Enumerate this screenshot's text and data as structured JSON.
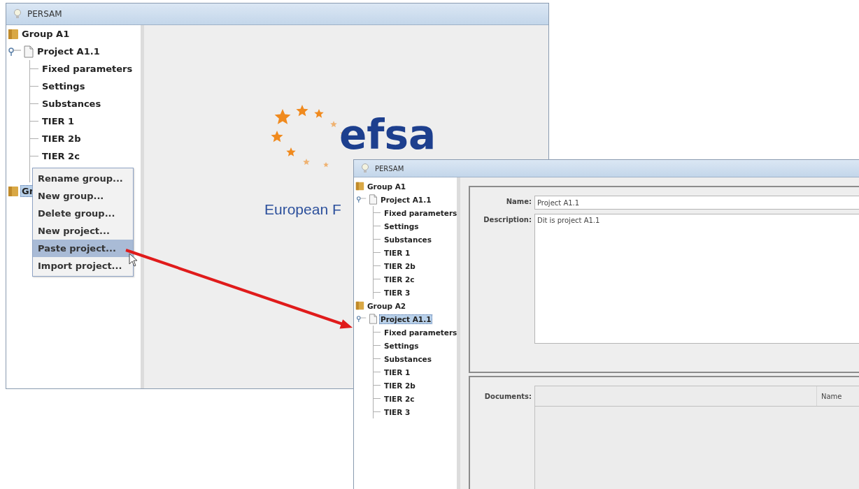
{
  "windows": [
    {
      "title": "PERSAM",
      "tree": [
        {
          "label": "Group A1",
          "kind": "group",
          "selected": false,
          "children": [
            {
              "label": "Project A1.1",
              "kind": "project",
              "selected": false,
              "children": [
                {
                  "label": "Fixed parameters",
                  "kind": "item",
                  "selected": false
                },
                {
                  "label": "Settings",
                  "kind": "item",
                  "selected": false
                },
                {
                  "label": "Substances",
                  "kind": "item",
                  "selected": false
                },
                {
                  "label": "TIER 1",
                  "kind": "item",
                  "selected": false
                },
                {
                  "label": "TIER 2b",
                  "kind": "item",
                  "selected": false
                },
                {
                  "label": "TIER 2c",
                  "kind": "item",
                  "selected": false
                }
              ]
            }
          ]
        },
        {
          "label": "Gr",
          "kind": "group",
          "selected": true
        }
      ],
      "context_menu": [
        {
          "label": "Rename group...",
          "selected": false
        },
        {
          "label": "New group...",
          "selected": false
        },
        {
          "label": "Delete group...",
          "selected": false
        },
        {
          "label": "New project...",
          "selected": false
        },
        {
          "label": "Paste project...",
          "selected": true
        },
        {
          "label": "Import project...",
          "selected": false
        }
      ],
      "logo": {
        "name": "efsa",
        "subtitle": "European F"
      }
    },
    {
      "title": "PERSAM",
      "tree": [
        {
          "label": "Group A1",
          "kind": "group",
          "selected": false,
          "children": [
            {
              "label": "Project A1.1",
              "kind": "project",
              "selected": false,
              "children": [
                {
                  "label": "Fixed parameters",
                  "kind": "item",
                  "selected": false
                },
                {
                  "label": "Settings",
                  "kind": "item",
                  "selected": false
                },
                {
                  "label": "Substances",
                  "kind": "item",
                  "selected": false
                },
                {
                  "label": "TIER 1",
                  "kind": "item",
                  "selected": false
                },
                {
                  "label": "TIER 2b",
                  "kind": "item",
                  "selected": false
                },
                {
                  "label": "TIER 2c",
                  "kind": "item",
                  "selected": false
                },
                {
                  "label": "TIER 3",
                  "kind": "item",
                  "selected": false
                }
              ]
            }
          ]
        },
        {
          "label": "Group A2",
          "kind": "group",
          "selected": false,
          "children": [
            {
              "label": "Project A1.1",
              "kind": "project",
              "selected": true,
              "children": [
                {
                  "label": "Fixed parameters",
                  "kind": "item",
                  "selected": false
                },
                {
                  "label": "Settings",
                  "kind": "item",
                  "selected": false
                },
                {
                  "label": "Substances",
                  "kind": "item",
                  "selected": false
                },
                {
                  "label": "TIER 1",
                  "kind": "item",
                  "selected": false
                },
                {
                  "label": "TIER 2b",
                  "kind": "item",
                  "selected": false
                },
                {
                  "label": "TIER 2c",
                  "kind": "item",
                  "selected": false
                },
                {
                  "label": "TIER 3",
                  "kind": "item",
                  "selected": false
                }
              ]
            }
          ]
        }
      ],
      "form": {
        "name_label": "Name:",
        "name_value": "Project A1.1",
        "description_label": "Description:",
        "description_value": "Dit is project A1.1",
        "documents_label": "Documents:",
        "documents_columns": [
          "Name"
        ]
      }
    }
  ]
}
